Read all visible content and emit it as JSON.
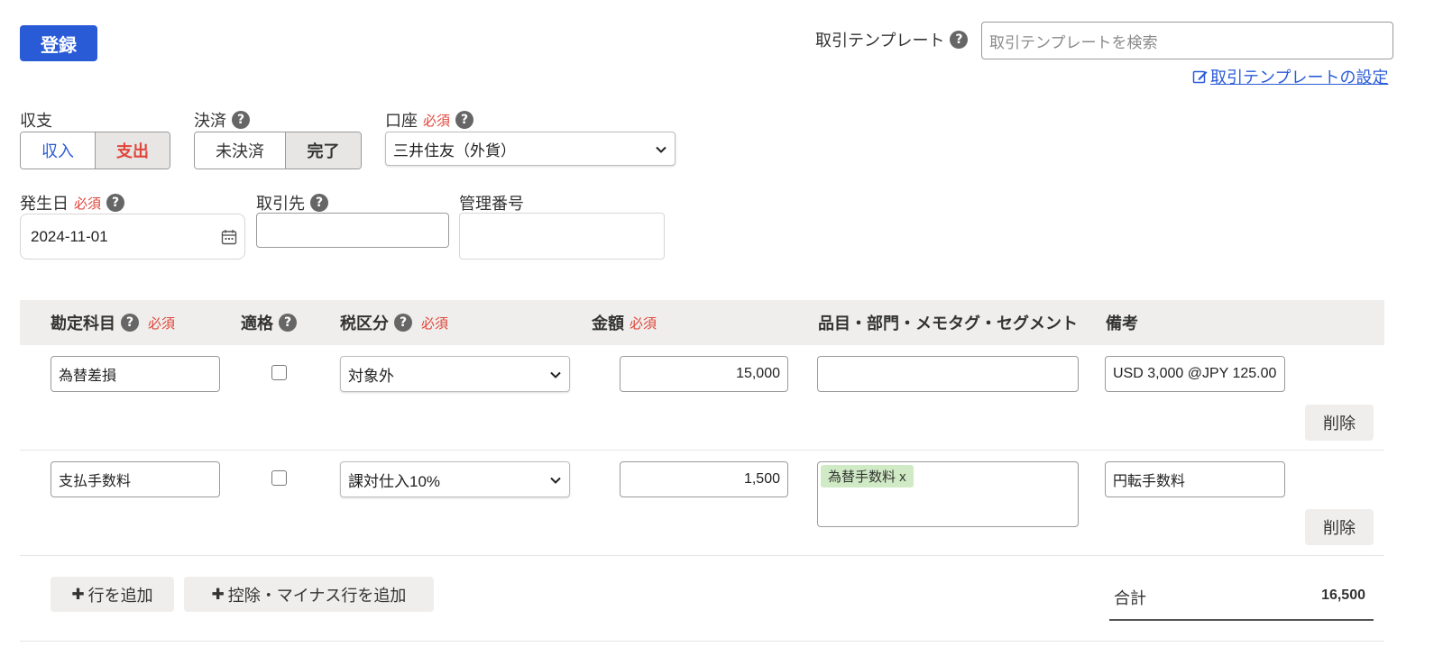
{
  "header": {
    "register_label": "登録",
    "template_label": "取引テンプレート",
    "template_search_placeholder": "取引テンプレートを検索",
    "template_settings_link": "取引テンプレートの設定"
  },
  "form": {
    "income_expense": {
      "label": "収支",
      "options": [
        "収入",
        "支出"
      ],
      "selected": "支出"
    },
    "settlement": {
      "label": "決済",
      "options": [
        "未決済",
        "完了"
      ],
      "selected": "完了"
    },
    "account": {
      "label": "口座",
      "required": "必須",
      "value": "三井住友（外貨）"
    },
    "date": {
      "label": "発生日",
      "required": "必須",
      "value": "2024-11-01"
    },
    "partner": {
      "label": "取引先",
      "value": ""
    },
    "management_no": {
      "label": "管理番号",
      "value": ""
    }
  },
  "table": {
    "headers": {
      "account_item": "勘定科目",
      "qualified": "適格",
      "tax": "税区分",
      "amount": "金額",
      "tags": "品目・部門・メモタグ・セグメント",
      "note": "備考",
      "required": "必須"
    },
    "rows": [
      {
        "account_item": "為替差損",
        "qualified": false,
        "tax": "対象外",
        "amount": "15,000",
        "tags": [],
        "note": "USD 3,000 @JPY 125.00",
        "delete": "削除"
      },
      {
        "account_item": "支払手数料",
        "qualified": false,
        "tax": "課対仕入10%",
        "amount": "1,500",
        "tags": [
          "為替手数料 x"
        ],
        "note": "円転手数料",
        "delete": "削除"
      }
    ]
  },
  "footer": {
    "add_row": "行を追加",
    "add_deduction_row": "控除・マイナス行を追加",
    "total_label": "合計",
    "total_value": "16,500"
  },
  "icons": {
    "help": "?",
    "plus": "✚",
    "edit": "edit-icon",
    "calendar": "calendar-icon",
    "chevron": "chevron-down-icon"
  },
  "colors": {
    "primary": "#2a5bd7",
    "required": "#e0463b",
    "selected_expense": "#e0463b",
    "income": "#2a5bd7",
    "tag_bg": "#cfeac4",
    "header_bg": "#efeeec"
  }
}
